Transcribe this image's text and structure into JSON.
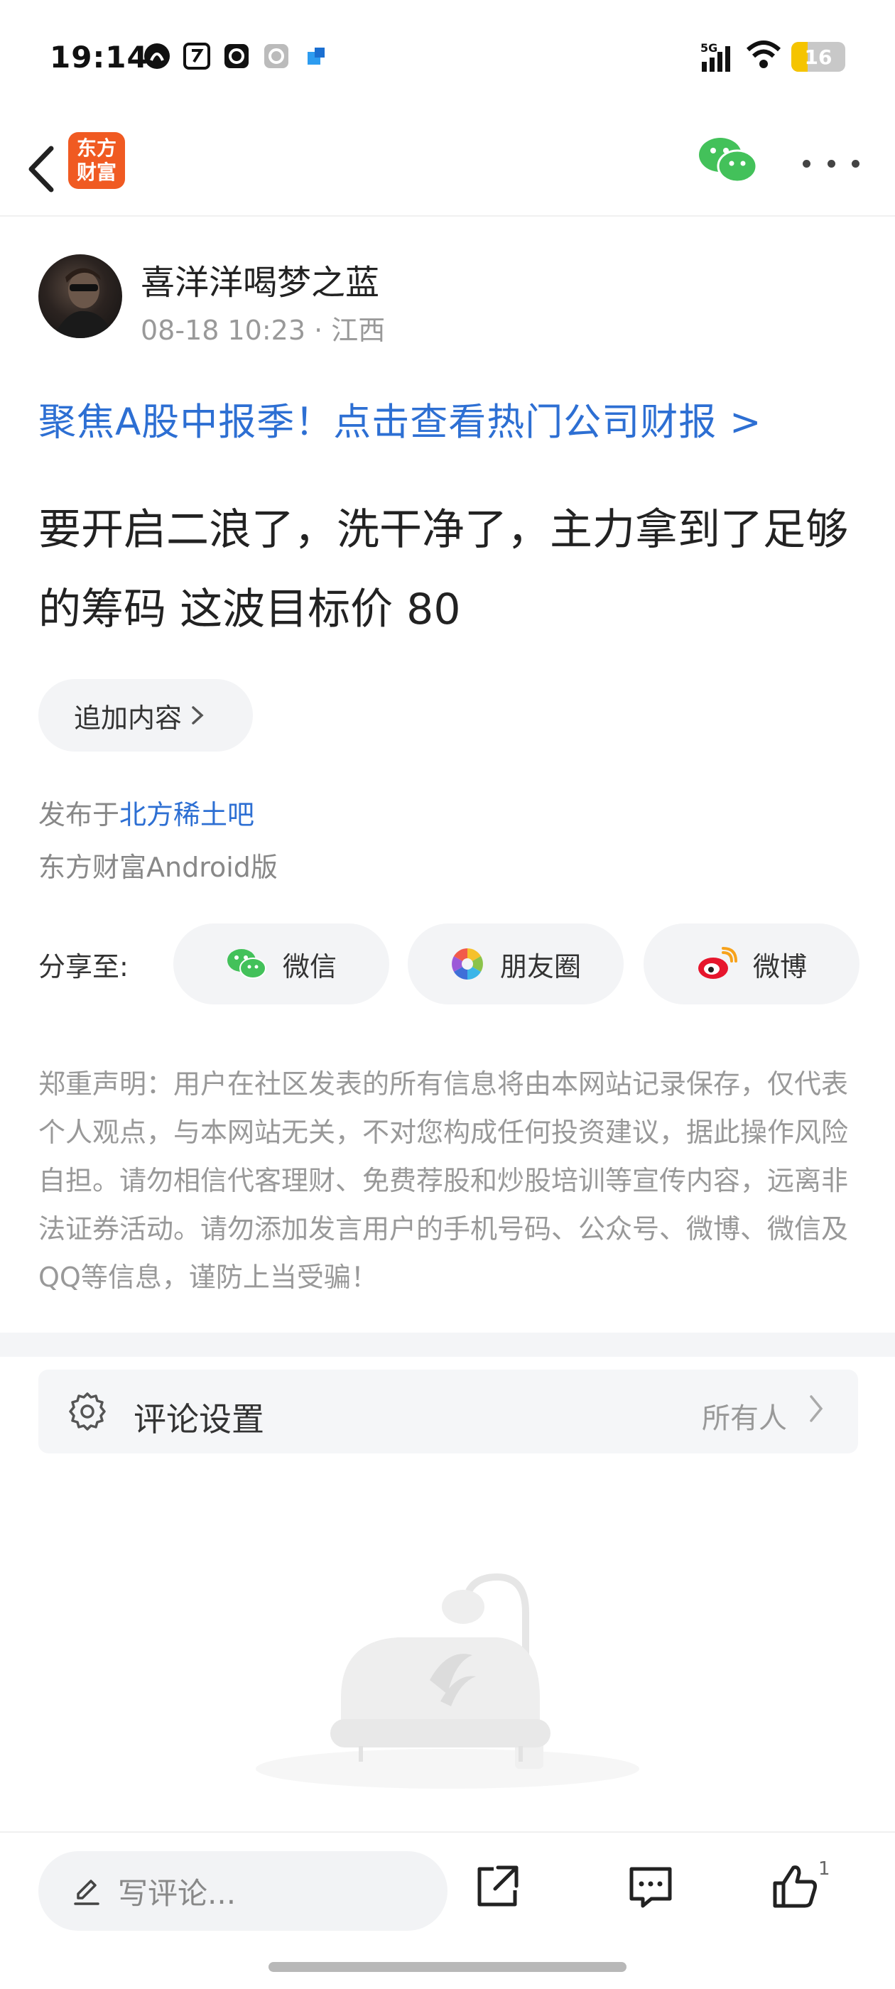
{
  "status_bar": {
    "time": "19:14",
    "network": "5G",
    "battery": "16"
  },
  "header": {
    "logo_line1": "东方",
    "logo_line2": "财富"
  },
  "post": {
    "author_name": "喜洋洋喝梦之蓝",
    "meta": "08-18 10:23 · 江西",
    "promo": "聚焦A股中报季！点击查看热门公司财报 >",
    "content": "要开启二浪了，洗干净了，主力拿到了足够的筹码 这波目标价 80",
    "append_label": "追加内容",
    "published_prefix": "发布于",
    "board": "北方稀土吧",
    "client": "东方财富Android版"
  },
  "share": {
    "label": "分享至:",
    "wechat": "微信",
    "moments": "朋友圈",
    "weibo": "微博"
  },
  "disclaimer": "郑重声明：用户在社区发表的所有信息将由本网站记录保存，仅代表个人观点，与本网站无关，不对您构成任何投资建议，据此操作风险自担。请勿相信代客理财、免费荐股和炒股培训等宣传内容，远离非法证券活动。请勿添加发言用户的手机号码、公众号、微博、微信及QQ等信息，谨防上当受骗！",
  "comment_settings": {
    "label": "评论设置",
    "value": "所有人"
  },
  "bottom_bar": {
    "placeholder": "写评论...",
    "like_count": "1"
  },
  "colors": {
    "accent_blue": "#2d6fd3",
    "brand_orange": "#f05a22",
    "wechat_green": "#43c15a"
  }
}
